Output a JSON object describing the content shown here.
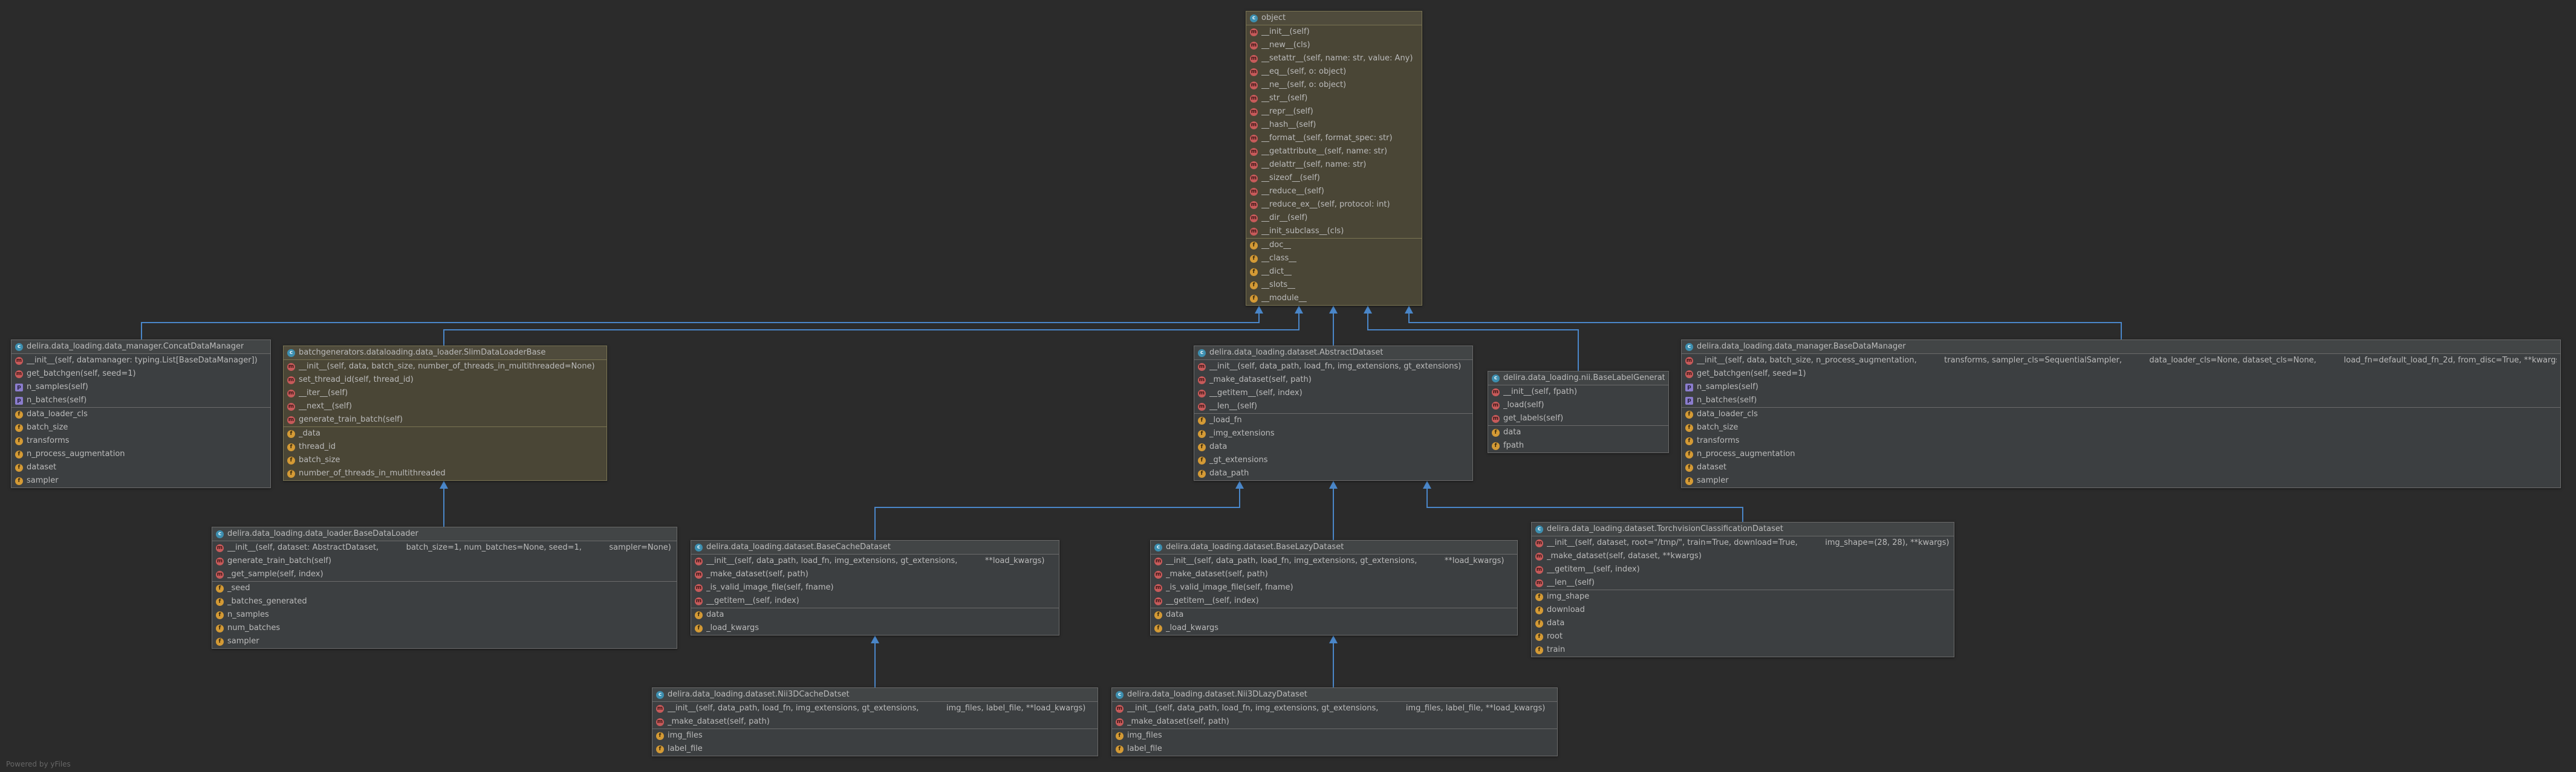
{
  "diagram": {
    "powered_by": "Powered by yFiles",
    "edge_color": "#4a86c8",
    "nodes": [
      {
        "id": "object",
        "title": "object",
        "highlight": true,
        "methods": [
          {
            "icon": "method",
            "text": "__init__(self)"
          },
          {
            "icon": "method",
            "text": "__new__(cls)"
          },
          {
            "icon": "method",
            "text": "__setattr__(self, name: str, value: Any)"
          },
          {
            "icon": "method",
            "text": "__eq__(self, o: object)"
          },
          {
            "icon": "method",
            "text": "__ne__(self, o: object)"
          },
          {
            "icon": "method",
            "text": "__str__(self)"
          },
          {
            "icon": "method",
            "text": "__repr__(self)"
          },
          {
            "icon": "method",
            "text": "__hash__(self)"
          },
          {
            "icon": "method",
            "text": "__format__(self, format_spec: str)"
          },
          {
            "icon": "method",
            "text": "__getattribute__(self, name: str)"
          },
          {
            "icon": "method",
            "text": "__delattr__(self, name: str)"
          },
          {
            "icon": "method",
            "text": "__sizeof__(self)"
          },
          {
            "icon": "method",
            "text": "__reduce__(self)"
          },
          {
            "icon": "method",
            "text": "__reduce_ex__(self, protocol: int)"
          },
          {
            "icon": "method",
            "text": "__dir__(self)"
          },
          {
            "icon": "method",
            "text": "__init_subclass__(cls)"
          }
        ],
        "fields": [
          "__doc__",
          "__class__",
          "__dict__",
          "__slots__",
          "__module__"
        ]
      },
      {
        "id": "concat",
        "title": "delira.data_loading.data_manager.ConcatDataManager",
        "highlight": false,
        "methods": [
          {
            "icon": "method",
            "text": "__init__(self, datamanager: typing.List[BaseDataManager])"
          },
          {
            "icon": "method",
            "text": "get_batchgen(self, seed=1)"
          },
          {
            "icon": "property",
            "text": "n_samples(self)"
          },
          {
            "icon": "property",
            "text": "n_batches(self)"
          }
        ],
        "fields": [
          "data_loader_cls",
          "batch_size",
          "transforms",
          "n_process_augmentation",
          "dataset",
          "sampler"
        ]
      },
      {
        "id": "slim",
        "title": "batchgenerators.dataloading.data_loader.SlimDataLoaderBase",
        "highlight": true,
        "methods": [
          {
            "icon": "method",
            "text": "__init__(self, data, batch_size, number_of_threads_in_multithreaded=None)"
          },
          {
            "icon": "method",
            "text": "set_thread_id(self, thread_id)"
          },
          {
            "icon": "method",
            "text": "__iter__(self)"
          },
          {
            "icon": "method",
            "text": "__next__(self)"
          },
          {
            "icon": "method",
            "text": "generate_train_batch(self)"
          }
        ],
        "fields": [
          "_data",
          "thread_id",
          "batch_size",
          "number_of_threads_in_multithreaded"
        ]
      },
      {
        "id": "abstract",
        "title": "delira.data_loading.dataset.AbstractDataset",
        "highlight": false,
        "methods": [
          {
            "icon": "method",
            "text": "__init__(self, data_path, load_fn, img_extensions, gt_extensions)"
          },
          {
            "icon": "method",
            "text": "_make_dataset(self, path)"
          },
          {
            "icon": "method",
            "text": "__getitem__(self, index)"
          },
          {
            "icon": "method",
            "text": "__len__(self)"
          }
        ],
        "fields": [
          "_load_fn",
          "_img_extensions",
          "data",
          "_gt_extensions",
          "data_path"
        ]
      },
      {
        "id": "nii",
        "title": "delira.data_loading.nii.BaseLabelGenerator",
        "highlight": false,
        "methods": [
          {
            "icon": "method",
            "text": "__init__(self, fpath)"
          },
          {
            "icon": "method",
            "text": "_load(self)"
          },
          {
            "icon": "method",
            "text": "get_labels(self)"
          }
        ],
        "fields": [
          "data",
          "fpath"
        ]
      },
      {
        "id": "basedm",
        "title": "delira.data_loading.data_manager.BaseDataManager",
        "highlight": false,
        "methods": [
          {
            "icon": "method",
            "text": "__init__(self, data, batch_size, n_process_augmentation,           transforms, sampler_cls=SequentialSampler,           data_loader_cls=None, dataset_cls=None,           load_fn=default_load_fn_2d, from_disc=True, **kwargs)"
          },
          {
            "icon": "method",
            "text": "get_batchgen(self, seed=1)"
          },
          {
            "icon": "property",
            "text": "n_samples(self)"
          },
          {
            "icon": "property",
            "text": "n_batches(self)"
          }
        ],
        "fields": [
          "data_loader_cls",
          "batch_size",
          "transforms",
          "n_process_augmentation",
          "dataset",
          "sampler"
        ]
      },
      {
        "id": "basedl",
        "title": "delira.data_loading.data_loader.BaseDataLoader",
        "highlight": false,
        "methods": [
          {
            "icon": "method",
            "text": "__init__(self, dataset: AbstractDataset,           batch_size=1, num_batches=None, seed=1,           sampler=None)"
          },
          {
            "icon": "method",
            "text": "generate_train_batch(self)"
          },
          {
            "icon": "method",
            "text": "_get_sample(self, index)"
          }
        ],
        "fields": [
          "_seed",
          "_batches_generated",
          "n_samples",
          "num_batches",
          "sampler"
        ]
      },
      {
        "id": "cache",
        "title": "delira.data_loading.dataset.BaseCacheDataset",
        "highlight": false,
        "methods": [
          {
            "icon": "method",
            "text": "__init__(self, data_path, load_fn, img_extensions, gt_extensions,           **load_kwargs)"
          },
          {
            "icon": "method",
            "text": "_make_dataset(self, path)"
          },
          {
            "icon": "method",
            "text": "_is_valid_image_file(self, fname)"
          },
          {
            "icon": "method",
            "text": "__getitem__(self, index)"
          }
        ],
        "fields": [
          "data",
          "_load_kwargs"
        ]
      },
      {
        "id": "lazy",
        "title": "delira.data_loading.dataset.BaseLazyDataset",
        "highlight": false,
        "methods": [
          {
            "icon": "method",
            "text": "__init__(self, data_path, load_fn, img_extensions, gt_extensions,           **load_kwargs)"
          },
          {
            "icon": "method",
            "text": "_make_dataset(self, path)"
          },
          {
            "icon": "method",
            "text": "_is_valid_image_file(self, fname)"
          },
          {
            "icon": "method",
            "text": "__getitem__(self, index)"
          }
        ],
        "fields": [
          "data",
          "_load_kwargs"
        ]
      },
      {
        "id": "torch",
        "title": "delira.data_loading.dataset.TorchvisionClassificationDataset",
        "highlight": false,
        "methods": [
          {
            "icon": "method",
            "text": "__init__(self, dataset, root=\"/tmp/\", train=True, download=True,           img_shape=(28, 28), **kwargs)"
          },
          {
            "icon": "method",
            "text": "_make_dataset(self, dataset, **kwargs)"
          },
          {
            "icon": "method",
            "text": "__getitem__(self, index)"
          },
          {
            "icon": "method",
            "text": "__len__(self)"
          }
        ],
        "fields": [
          "img_shape",
          "download",
          "data",
          "root",
          "train"
        ]
      },
      {
        "id": "nii3dcache",
        "title": "delira.data_loading.dataset.Nii3DCacheDatset",
        "highlight": false,
        "methods": [
          {
            "icon": "method",
            "text": "__init__(self, data_path, load_fn, img_extensions, gt_extensions,           img_files, label_file, **load_kwargs)"
          },
          {
            "icon": "method",
            "text": "_make_dataset(self, path)"
          }
        ],
        "fields": [
          "img_files",
          "label_file"
        ]
      },
      {
        "id": "nii3dlazy",
        "title": "delira.data_loading.dataset.Nii3DLazyDataset",
        "highlight": false,
        "methods": [
          {
            "icon": "method",
            "text": "__init__(self, data_path, load_fn, img_extensions, gt_extensions,           img_files, label_file, **load_kwargs)"
          },
          {
            "icon": "method",
            "text": "_make_dataset(self, path)"
          }
        ],
        "fields": [
          "img_files",
          "label_file"
        ]
      }
    ],
    "edges": [
      {
        "from": "concat",
        "to": "object"
      },
      {
        "from": "slim",
        "to": "object"
      },
      {
        "from": "abstract",
        "to": "object"
      },
      {
        "from": "nii",
        "to": "object"
      },
      {
        "from": "basedm",
        "to": "object"
      },
      {
        "from": "basedl",
        "to": "slim"
      },
      {
        "from": "cache",
        "to": "abstract"
      },
      {
        "from": "lazy",
        "to": "abstract"
      },
      {
        "from": "torch",
        "to": "abstract"
      },
      {
        "from": "nii3dcache",
        "to": "cache"
      },
      {
        "from": "nii3dlazy",
        "to": "lazy"
      }
    ]
  }
}
